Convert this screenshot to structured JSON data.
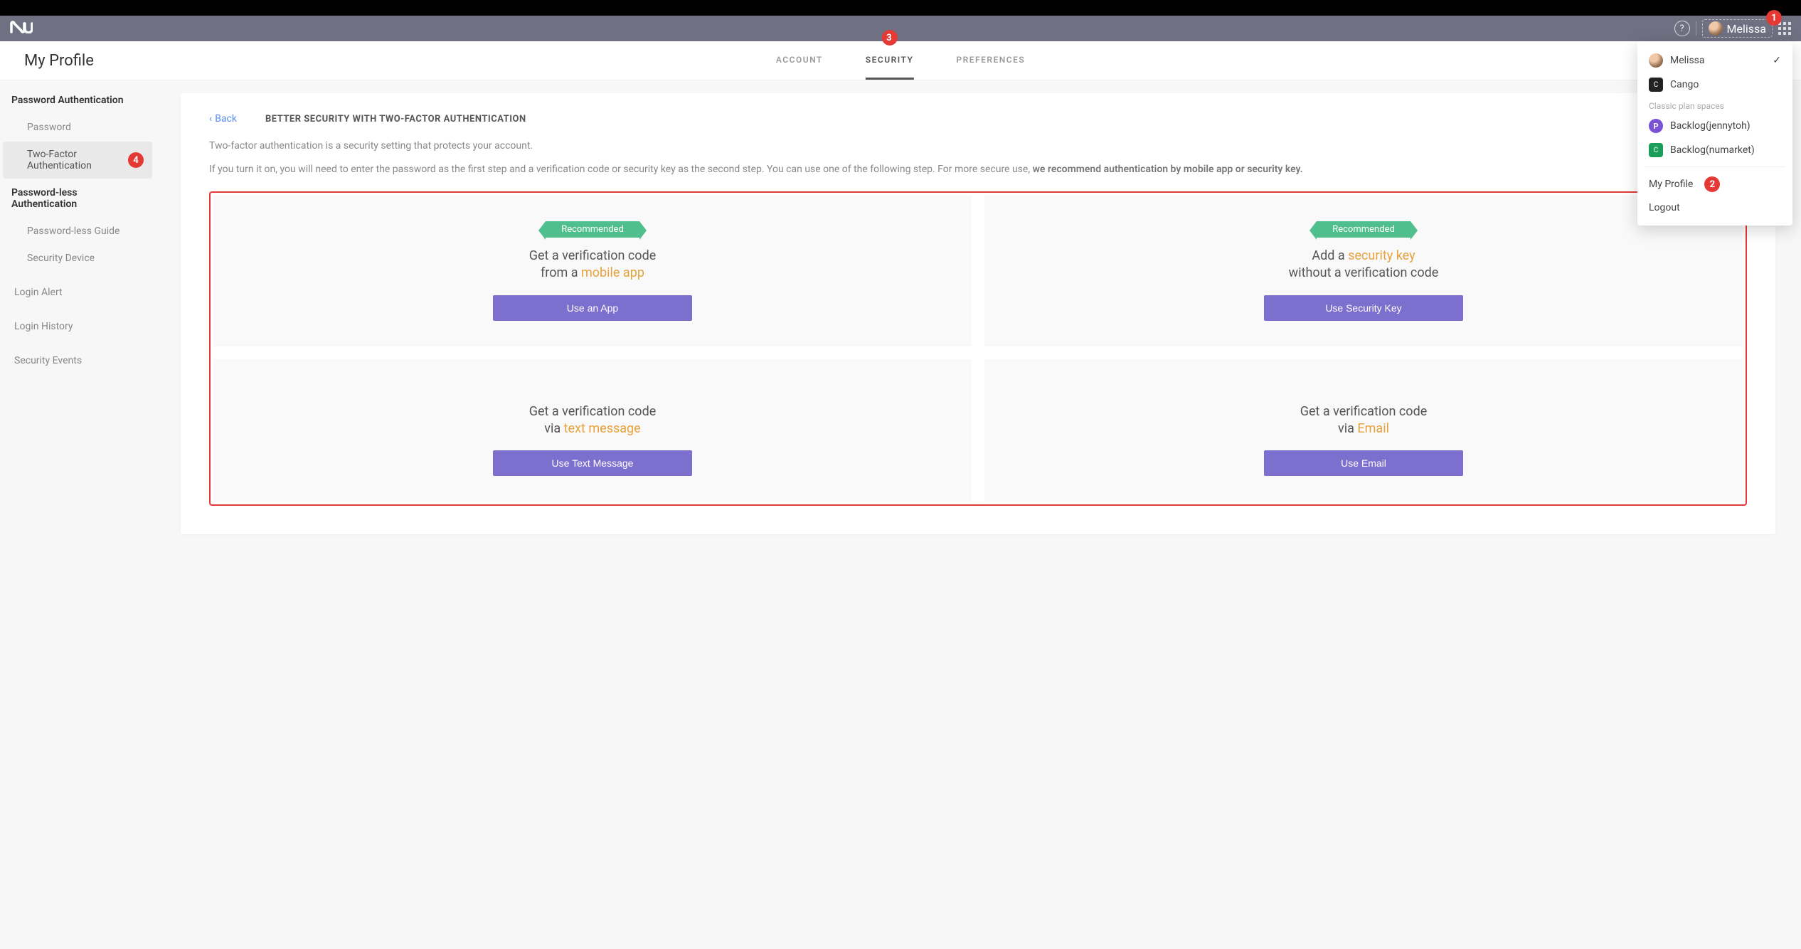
{
  "topbar": {
    "user_name": "Melissa"
  },
  "page_title": "My Profile",
  "tabs": [
    {
      "label": "ACCOUNT",
      "active": false
    },
    {
      "label": "SECURITY",
      "active": true
    },
    {
      "label": "PREFERENCES",
      "active": false
    }
  ],
  "sidebar": {
    "section1_title": "Password Authentication",
    "password_label": "Password",
    "twofa_label": "Two-Factor Authentication",
    "section2_title": "Password-less Authentication",
    "pwless_guide_label": "Password-less Guide",
    "security_device_label": "Security Device",
    "login_alert_label": "Login Alert",
    "login_history_label": "Login History",
    "security_events_label": "Security Events"
  },
  "content": {
    "back_label": "Back",
    "heading": "BETTER SECURITY WITH TWO-FACTOR AUTHENTICATION",
    "desc1": "Two-factor authentication is a security setting that protects your account.",
    "desc2_a": "If you turn it on, you will need to enter the password as the first step and a verification code or security key as the second step. You can use one of the following step. For more secure use, ",
    "desc2_b": "we recommend authentication by mobile app or security key."
  },
  "methods": {
    "recommended_label": "Recommended",
    "app": {
      "line1": "Get a verification code",
      "line2_a": "from a ",
      "line2_b": "mobile app",
      "btn": "Use an App"
    },
    "key": {
      "line1_a": "Add a ",
      "line1_b": "security key",
      "line2": "without a verification code",
      "btn": "Use Security Key"
    },
    "sms": {
      "line1": "Get a verification code",
      "line2_a": "via ",
      "line2_b": "text message",
      "btn": "Use Text Message"
    },
    "email": {
      "line1": "Get a verification code",
      "line2_a": "via ",
      "line2_b": "Email",
      "btn": "Use Email"
    }
  },
  "dropdown": {
    "melissa_label": "Melissa",
    "cango_label": "Cango",
    "classic_label": "Classic plan spaces",
    "backlog_jenny_label": "Backlog(jennytoh)",
    "backlog_numarket_label": "Backlog(numarket)",
    "my_profile_label": "My Profile",
    "logout_label": "Logout"
  },
  "annotations": {
    "n1": "1",
    "n2": "2",
    "n3": "3",
    "n4": "4"
  }
}
